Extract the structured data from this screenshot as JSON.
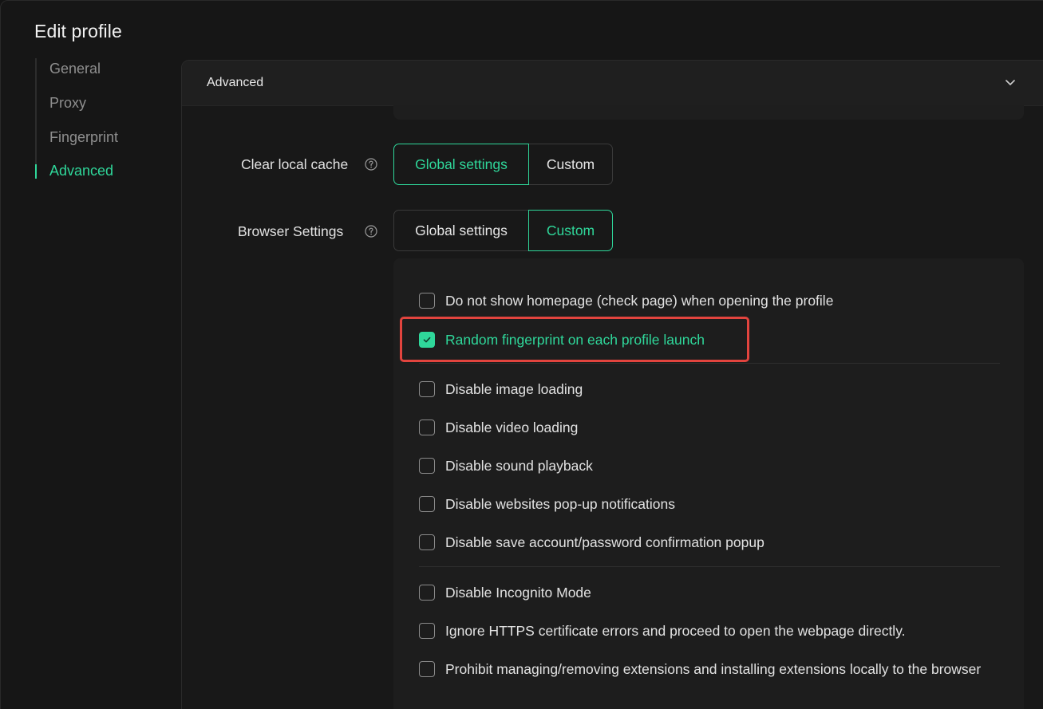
{
  "page_title": "Edit profile",
  "nav": {
    "items": [
      {
        "label": "General",
        "active": false
      },
      {
        "label": "Proxy",
        "active": false
      },
      {
        "label": "Fingerprint",
        "active": false
      },
      {
        "label": "Advanced",
        "active": true
      }
    ]
  },
  "section": {
    "title": "Advanced",
    "chevron_icon": "chevron-down-icon"
  },
  "clear_cache": {
    "label": "Clear local cache",
    "help_icon": "question-circle-icon",
    "options": [
      "Global settings",
      "Custom"
    ],
    "selected": "Global settings"
  },
  "browser_settings": {
    "label": "Browser Settings",
    "help_icon": "question-circle-icon",
    "options": [
      "Global settings",
      "Custom"
    ],
    "selected": "Custom"
  },
  "checkboxes": [
    {
      "label": "Do not show homepage (check page) when opening the profile",
      "checked": false
    },
    {
      "label": "Random fingerprint on each profile launch",
      "checked": true
    },
    {
      "label": "Disable image loading",
      "checked": false
    },
    {
      "label": "Disable video loading",
      "checked": false
    },
    {
      "label": "Disable sound playback",
      "checked": false
    },
    {
      "label": "Disable websites pop-up notifications",
      "checked": false
    },
    {
      "label": "Disable save account/password confirmation popup",
      "checked": false
    },
    {
      "label": "Disable Incognito Mode",
      "checked": false
    },
    {
      "label": "Ignore HTTPS certificate errors and proceed to open the webpage directly.",
      "checked": false
    },
    {
      "label": "Prohibit managing/removing extensions and installing extensions locally to the browser",
      "checked": false
    }
  ],
  "colors": {
    "accent": "#2fd79a",
    "highlight": "#e2443e",
    "background": "#161616"
  }
}
